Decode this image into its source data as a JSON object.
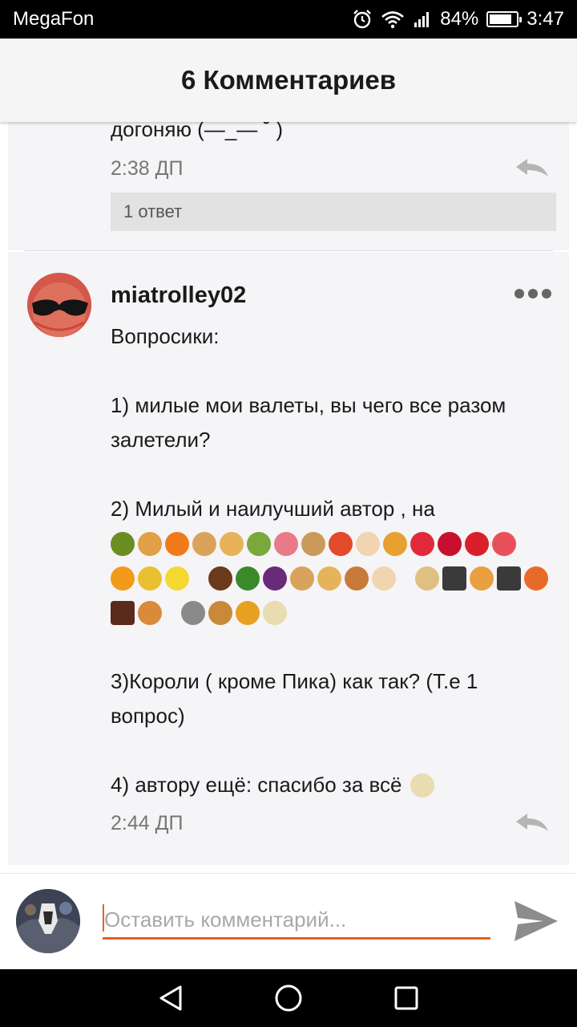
{
  "status_bar": {
    "carrier": "MegaFon",
    "battery_percent": "84%",
    "time": "3:47",
    "battery_level": 0.84,
    "icons": [
      "alarm-icon",
      "wifi-icon",
      "signal-icon",
      "battery-icon"
    ]
  },
  "header": {
    "title": "6 Комментариев"
  },
  "comments": [
    {
      "text_tail": "догоняю (—_— ˘ )",
      "time": "2:38 ДП",
      "replies_label": "1 ответ"
    },
    {
      "username": "miatrolley02",
      "intro": "Вопросики:",
      "q1": "1) милые мои валеты, вы чего  все разом залетели?",
      "q2": "2) Милый и наилучший автор , на",
      "q3": "3)Короли ( кроме Пика) как так? (Т.е 1 вопрос)",
      "q4": "4) автору ещё: спасибо за всё",
      "time": "2:44 ДП"
    }
  ],
  "composer": {
    "placeholder": "Оставить комментарий...",
    "accent_color": "#e8611c"
  }
}
